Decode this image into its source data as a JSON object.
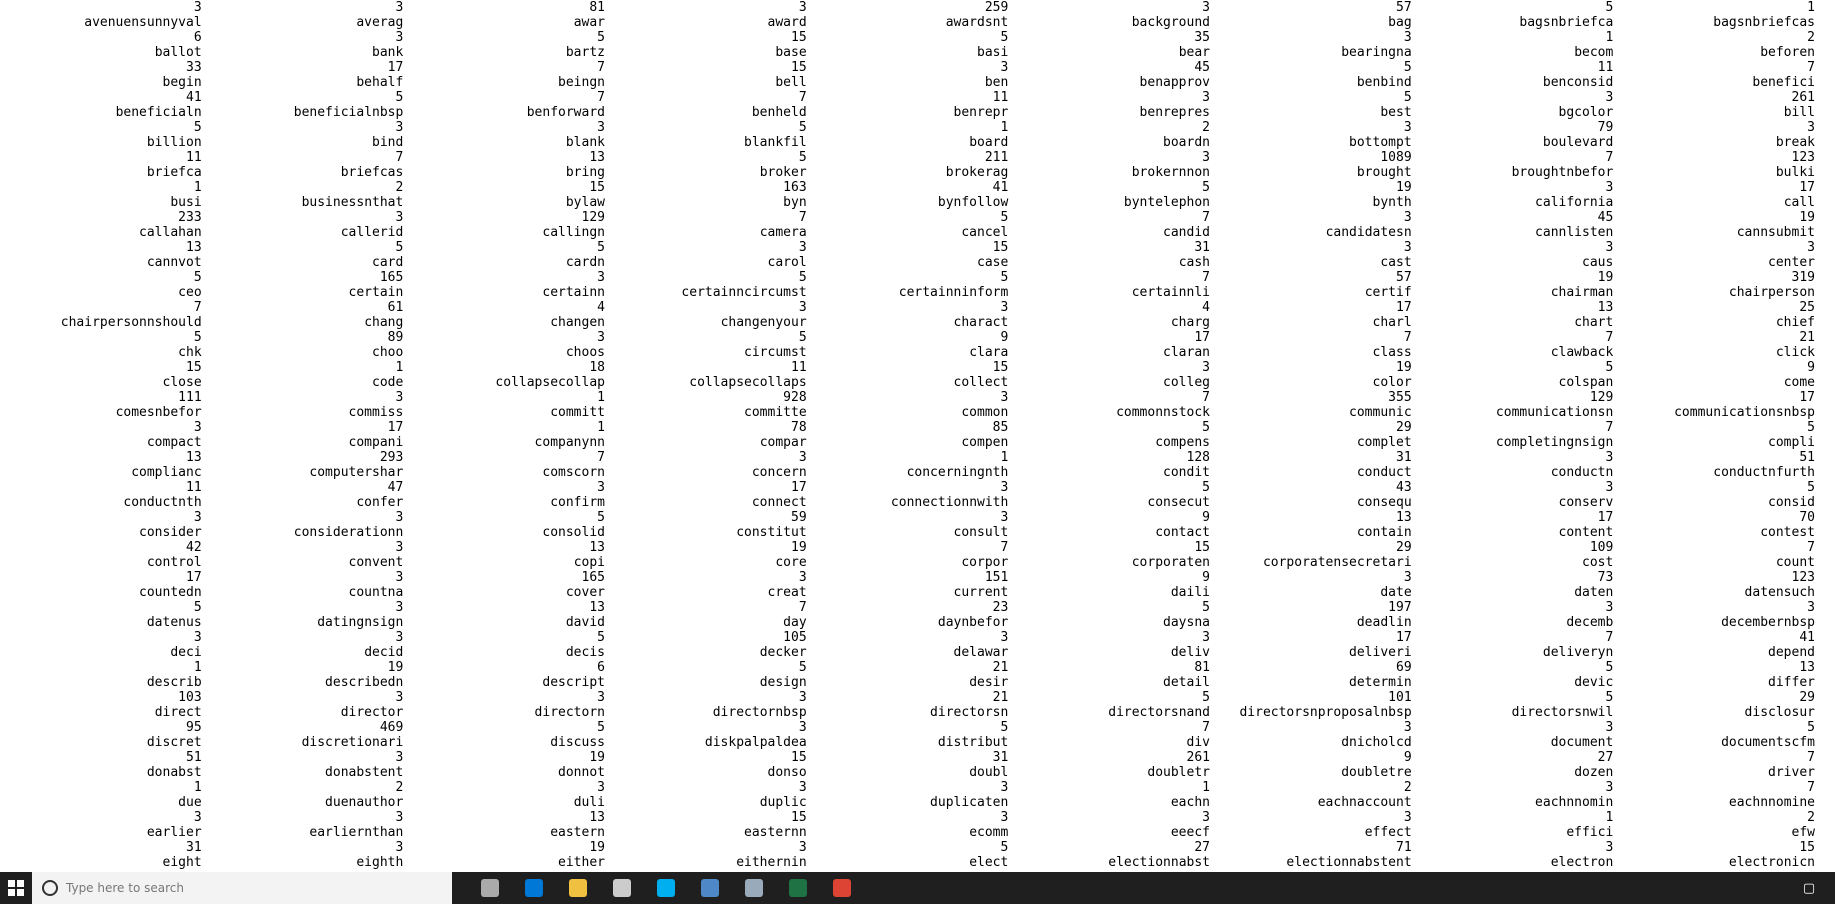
{
  "console": {
    "rows": [
      [
        "3",
        "3",
        "81",
        "3",
        "259",
        "3",
        "57",
        "5",
        "1"
      ],
      [
        "avenuensunnyval",
        "averag",
        "awar",
        "award",
        "awardsnt",
        "background",
        "bag",
        "bagsnbriefca",
        "bagsnbriefcas"
      ],
      [
        "6",
        "3",
        "5",
        "15",
        "5",
        "35",
        "3",
        "1",
        "2"
      ],
      [
        "ballot",
        "bank",
        "bartz",
        "base",
        "basi",
        "bear",
        "bearingna",
        "becom",
        "beforen"
      ],
      [
        "33",
        "17",
        "7",
        "15",
        "3",
        "45",
        "5",
        "11",
        "7"
      ],
      [
        "begin",
        "behalf",
        "beingn",
        "bell",
        "ben",
        "benapprov",
        "benbind",
        "benconsid",
        "benefici"
      ],
      [
        "41",
        "5",
        "7",
        "7",
        "11",
        "3",
        "5",
        "3",
        "261"
      ],
      [
        "beneficialn",
        "beneficialnbsp",
        "benforward",
        "benheld",
        "benrepr",
        "benrepres",
        "best",
        "bgcolor",
        "bill"
      ],
      [
        "5",
        "3",
        "3",
        "5",
        "1",
        "2",
        "3",
        "79",
        "3"
      ],
      [
        "billion",
        "bind",
        "blank",
        "blankfil",
        "board",
        "boardn",
        "bottompt",
        "boulevard",
        "break"
      ],
      [
        "11",
        "7",
        "13",
        "5",
        "211",
        "3",
        "1089",
        "7",
        "123"
      ],
      [
        "briefca",
        "briefcas",
        "bring",
        "broker",
        "brokerag",
        "brokernnon",
        "brought",
        "broughtnbefor",
        "bulki"
      ],
      [
        "1",
        "2",
        "15",
        "163",
        "41",
        "5",
        "19",
        "3",
        "17"
      ],
      [
        "busi",
        "businessnthat",
        "bylaw",
        "byn",
        "bynfollow",
        "byntelephon",
        "bynth",
        "california",
        "call"
      ],
      [
        "233",
        "3",
        "129",
        "7",
        "5",
        "7",
        "3",
        "45",
        "19"
      ],
      [
        "callahan",
        "callerid",
        "callingn",
        "camera",
        "cancel",
        "candid",
        "candidatesn",
        "cannlisten",
        "cannsubmit"
      ],
      [
        "13",
        "5",
        "5",
        "3",
        "15",
        "31",
        "3",
        "3",
        "3"
      ],
      [
        "cannvot",
        "card",
        "cardn",
        "carol",
        "case",
        "cash",
        "cast",
        "caus",
        "center"
      ],
      [
        "5",
        "165",
        "3",
        "5",
        "5",
        "7",
        "57",
        "19",
        "319"
      ],
      [
        "ceo",
        "certain",
        "certainn",
        "certainncircumst",
        "certainninform",
        "certainnli",
        "certif",
        "chairman",
        "chairperson"
      ],
      [
        "7",
        "61",
        "4",
        "3",
        "3",
        "4",
        "17",
        "13",
        "25"
      ],
      [
        "chairpersonnshould",
        "chang",
        "changen",
        "changenyour",
        "charact",
        "charg",
        "charl",
        "chart",
        "chief"
      ],
      [
        "5",
        "89",
        "3",
        "5",
        "9",
        "17",
        "7",
        "7",
        "21"
      ],
      [
        "chk",
        "choo",
        "choos",
        "circumst",
        "clara",
        "claran",
        "class",
        "clawback",
        "click"
      ],
      [
        "15",
        "1",
        "18",
        "11",
        "15",
        "3",
        "19",
        "5",
        "9"
      ],
      [
        "close",
        "code",
        "collapsecollap",
        "collapsecollaps",
        "collect",
        "colleg",
        "color",
        "colspan",
        "come"
      ],
      [
        "111",
        "3",
        "1",
        "928",
        "3",
        "7",
        "355",
        "129",
        "17"
      ],
      [
        "comesnbefor",
        "commiss",
        "committ",
        "committe",
        "common",
        "commonnstock",
        "communic",
        "communicationsn",
        "communicationsnbsp"
      ],
      [
        "3",
        "17",
        "1",
        "78",
        "85",
        "5",
        "29",
        "7",
        "5"
      ],
      [
        "compact",
        "compani",
        "companynn",
        "compar",
        "compen",
        "compens",
        "complet",
        "completingnsign",
        "compli"
      ],
      [
        "13",
        "293",
        "7",
        "3",
        "1",
        "128",
        "31",
        "3",
        "51"
      ],
      [
        "complianc",
        "computershar",
        "comscorn",
        "concern",
        "concerningnth",
        "condit",
        "conduct",
        "conductn",
        "conductnfurth"
      ],
      [
        "11",
        "47",
        "3",
        "17",
        "3",
        "5",
        "43",
        "3",
        "5"
      ],
      [
        "conductnth",
        "confer",
        "confirm",
        "connect",
        "connectionnwith",
        "consecut",
        "consequ",
        "conserv",
        "consid"
      ],
      [
        "3",
        "3",
        "5",
        "59",
        "3",
        "9",
        "13",
        "17",
        "70"
      ],
      [
        "consider",
        "considerationn",
        "consolid",
        "constitut",
        "consult",
        "contact",
        "contain",
        "content",
        "contest"
      ],
      [
        "42",
        "3",
        "13",
        "19",
        "7",
        "15",
        "29",
        "109",
        "7"
      ],
      [
        "control",
        "convent",
        "copi",
        "core",
        "corpor",
        "corporaten",
        "corporatensecretari",
        "cost",
        "count"
      ],
      [
        "17",
        "3",
        "165",
        "3",
        "151",
        "9",
        "3",
        "73",
        "123"
      ],
      [
        "countedn",
        "countna",
        "cover",
        "creat",
        "current",
        "daili",
        "date",
        "daten",
        "datensuch"
      ],
      [
        "5",
        "3",
        "13",
        "7",
        "23",
        "5",
        "197",
        "3",
        "3"
      ],
      [
        "datenus",
        "datingnsign",
        "david",
        "day",
        "daynbefor",
        "daysna",
        "deadlin",
        "decemb",
        "decembernbsp"
      ],
      [
        "3",
        "3",
        "5",
        "105",
        "3",
        "3",
        "17",
        "7",
        "41"
      ],
      [
        "deci",
        "decid",
        "decis",
        "decker",
        "delawar",
        "deliv",
        "deliveri",
        "deliveryn",
        "depend"
      ],
      [
        "1",
        "19",
        "6",
        "5",
        "21",
        "81",
        "69",
        "5",
        "13"
      ],
      [
        "describ",
        "describedn",
        "descript",
        "design",
        "desir",
        "detail",
        "determin",
        "devic",
        "differ"
      ],
      [
        "103",
        "3",
        "3",
        "3",
        "21",
        "5",
        "101",
        "5",
        "29"
      ],
      [
        "direct",
        "director",
        "directorn",
        "directornbsp",
        "directorsn",
        "directorsnand",
        "directorsnproposalnbsp",
        "directorsnwil",
        "disclosur"
      ],
      [
        "95",
        "469",
        "5",
        "3",
        "5",
        "7",
        "3",
        "3",
        "5"
      ],
      [
        "discret",
        "discretionari",
        "discuss",
        "diskpalpaldea",
        "distribut",
        "div",
        "dnicholcd",
        "document",
        "documentscfm"
      ],
      [
        "51",
        "3",
        "19",
        "15",
        "31",
        "261",
        "9",
        "27",
        "7"
      ],
      [
        "donabst",
        "donabstent",
        "donnot",
        "donso",
        "doubl",
        "doubletr",
        "doubletre",
        "dozen",
        "driver"
      ],
      [
        "1",
        "2",
        "3",
        "3",
        "3",
        "1",
        "2",
        "3",
        "7"
      ],
      [
        "due",
        "duenauthor",
        "duli",
        "duplic",
        "duplicaten",
        "eachn",
        "eachnaccount",
        "eachnnomin",
        "eachnnomine"
      ],
      [
        "3",
        "3",
        "13",
        "15",
        "3",
        "3",
        "3",
        "1",
        "2"
      ],
      [
        "earlier",
        "earliernthan",
        "eastern",
        "easternn",
        "ecomm",
        "eeecf",
        "effect",
        "effici",
        "efw"
      ],
      [
        "31",
        "3",
        "19",
        "3",
        "5",
        "27",
        "71",
        "3",
        "15"
      ],
      [
        "eight",
        "eighth",
        "either",
        "eithernin",
        "elect",
        "electionnabst",
        "electionnabstent",
        "electron",
        "electronicn"
      ]
    ]
  },
  "taskbar": {
    "search_placeholder": "Type here to search",
    "apps": [
      "task-view-icon",
      "edge-browser-icon",
      "file-explorer-icon",
      "store-icon",
      "skype-icon",
      "rstudio-icon",
      "image-viewer-icon",
      "excel-icon",
      "chrome-icon"
    ],
    "colors": {
      "bar": "#1f1f1f",
      "accent": "#0078d7"
    }
  }
}
